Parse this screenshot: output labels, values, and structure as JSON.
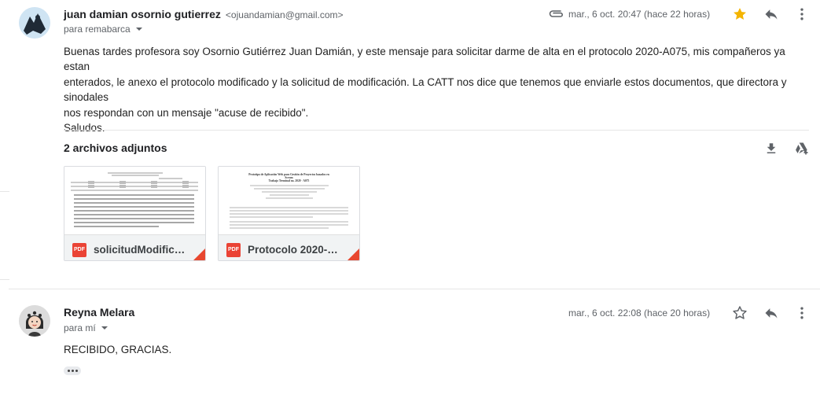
{
  "messages": [
    {
      "sender_name": "juan damian osornio gutierrez",
      "sender_email": "<ojuandamian@gmail.com>",
      "recipient_label": "para remabarca",
      "date": "mar., 6 oct. 20:47 (hace 22 horas)",
      "starred": true,
      "body": [
        "Buenas tardes profesora soy Osornio Gutiérrez Juan Damián, y este mensaje para solicitar darme de alta en el protocolo 2020-A075, mis compañeros ya estan",
        "enterados, le anexo el protocolo modificado y la solicitud de modificación. La CATT nos dice que tenemos que enviarle estos documentos, que directora y sinodales",
        "nos respondan con un mensaje \"acuse de recibido\".",
        "Saludos."
      ],
      "attachments_title": "2 archivos adjuntos",
      "attachments": [
        {
          "name": "solicitudModificaci...",
          "type": "PDF"
        },
        {
          "name": "Protocolo 2020-A0...",
          "type": "PDF",
          "preview_lines": [
            "Prototipo de Aplicación Web para Gestión de Proyectos basados en",
            "Scrum",
            "Trabajo Terminal no. 2020 - A075"
          ]
        }
      ]
    },
    {
      "sender_name": "Reyna Melara",
      "recipient_label": "para mí",
      "date": "mar., 6 oct. 22:08 (hace 20 horas)",
      "starred": false,
      "body": [
        "RECIBIDO, GRACIAS."
      ]
    }
  ],
  "colors": {
    "star": "#f4b400",
    "pdf": "#ea4335",
    "corner": "#e8472f"
  },
  "icons": [
    "paperclip-icon",
    "star-icon",
    "reply-icon",
    "more-vert-icon",
    "download-icon",
    "drive-add-icon",
    "pdf-icon",
    "avatar-icon"
  ]
}
